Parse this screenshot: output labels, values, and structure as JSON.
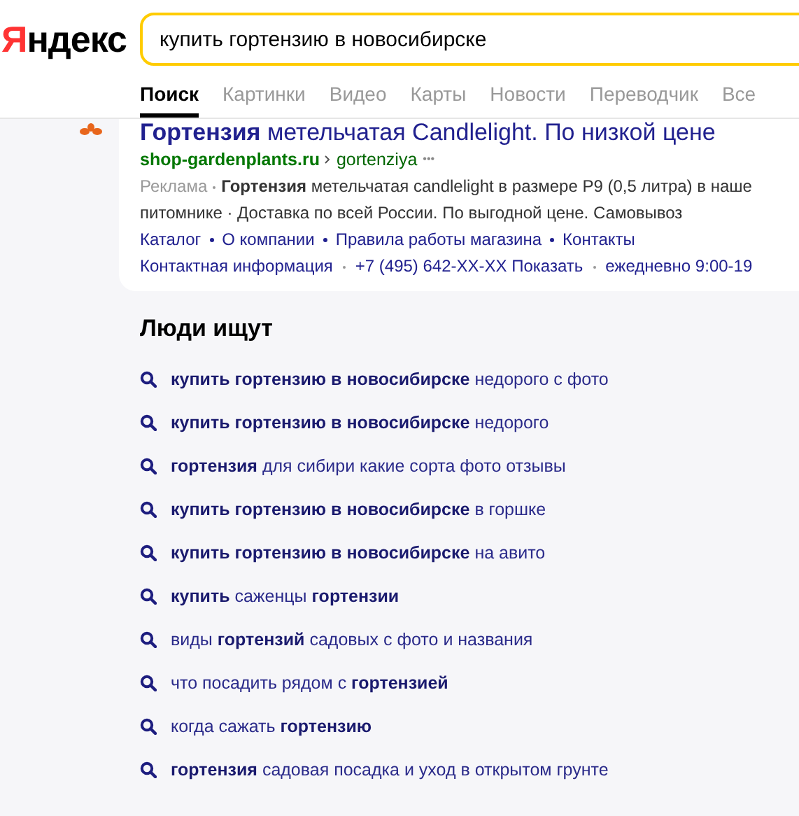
{
  "header": {
    "logo": "Яндекс",
    "search": {
      "value": "купить гортензию в новосибирске"
    },
    "tabs": [
      {
        "label": "Поиск",
        "selected": true
      },
      {
        "label": "Картинки",
        "selected": false
      },
      {
        "label": "Видео",
        "selected": false
      },
      {
        "label": "Карты",
        "selected": false
      },
      {
        "label": "Новости",
        "selected": false
      },
      {
        "label": "Переводчик",
        "selected": false
      },
      {
        "label": "Все",
        "selected": false
      }
    ]
  },
  "ad": {
    "title": "**Гортензия** метельчатая Candlelight. По низкой цене",
    "domain": "shop-gardenplants.ru",
    "path": "gortenziya",
    "more": "•••",
    "label": "Реклама",
    "description_1": "**Гортензия** метельчатая candlelight в размере P9 (0,5 литра) в наше",
    "description_2": "питомнике · Доставка по всей России. По выгодной цене. Самовывоз",
    "sitelinks": [
      "Каталог",
      "О компании",
      "Правила работы магазина",
      "Контакты"
    ],
    "contacts": [
      "Контактная информация",
      "+7 (495) 642-XX-XX Показать",
      "ежедневно 9:00-19"
    ]
  },
  "people_search": {
    "title": "Люди ищут",
    "items": [
      "**купить гортензию в новосибирске** недорого с фото",
      "**купить гортензию в новосибирске** недорого",
      "**гортензия** для сибири какие сорта фото отзывы",
      "**купить гортензию в новосибирске** в горшке",
      "**купить гортензию в новосибирске** на авито",
      "**купить** саженцы **гортензии**",
      "виды **гортензий** садовых с фото и названия",
      "что посадить рядом с **гортензией**",
      "когда сажать **гортензию**",
      "**гортензия** садовая посадка и уход в открытом грунте"
    ]
  }
}
